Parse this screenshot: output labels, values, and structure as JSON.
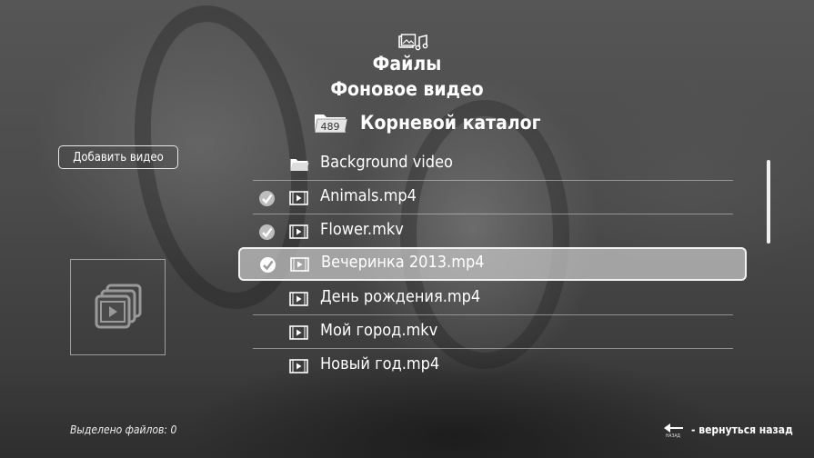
{
  "header": {
    "app_title": "Файлы",
    "section_title": "Фоновое видео",
    "icon": "files-media-icon"
  },
  "location": {
    "folder_badge": "489",
    "label": "Корневой каталог",
    "icon": "folder-icon"
  },
  "sidebar": {
    "add_button_label": "Добавить видео",
    "preview_icon": "video-files-stack-icon"
  },
  "file_list": [
    {
      "name": "Background video",
      "type": "folder",
      "checked": false,
      "selected": false
    },
    {
      "name": "Animals.mp4",
      "type": "video",
      "checked": true,
      "selected": false
    },
    {
      "name": "Flower.mkv",
      "type": "video",
      "checked": true,
      "selected": false
    },
    {
      "name": "Вечеринка 2013.mp4",
      "type": "video",
      "checked": true,
      "selected": true
    },
    {
      "name": "День рождения.mp4",
      "type": "video",
      "checked": false,
      "selected": false
    },
    {
      "name": "Мой город.mkv",
      "type": "video",
      "checked": false,
      "selected": false
    },
    {
      "name": "Новый год.mp4",
      "type": "video",
      "checked": false,
      "selected": false
    }
  ],
  "footer": {
    "selected_count_text": "Выделено файлов: 0",
    "back_hint_text": "- вернуться назад",
    "back_key_label": "НАЗАД"
  },
  "colors": {
    "text": "#ffffff",
    "selection_fill": "#c8c8c8",
    "divider": "#d2d2d2"
  }
}
